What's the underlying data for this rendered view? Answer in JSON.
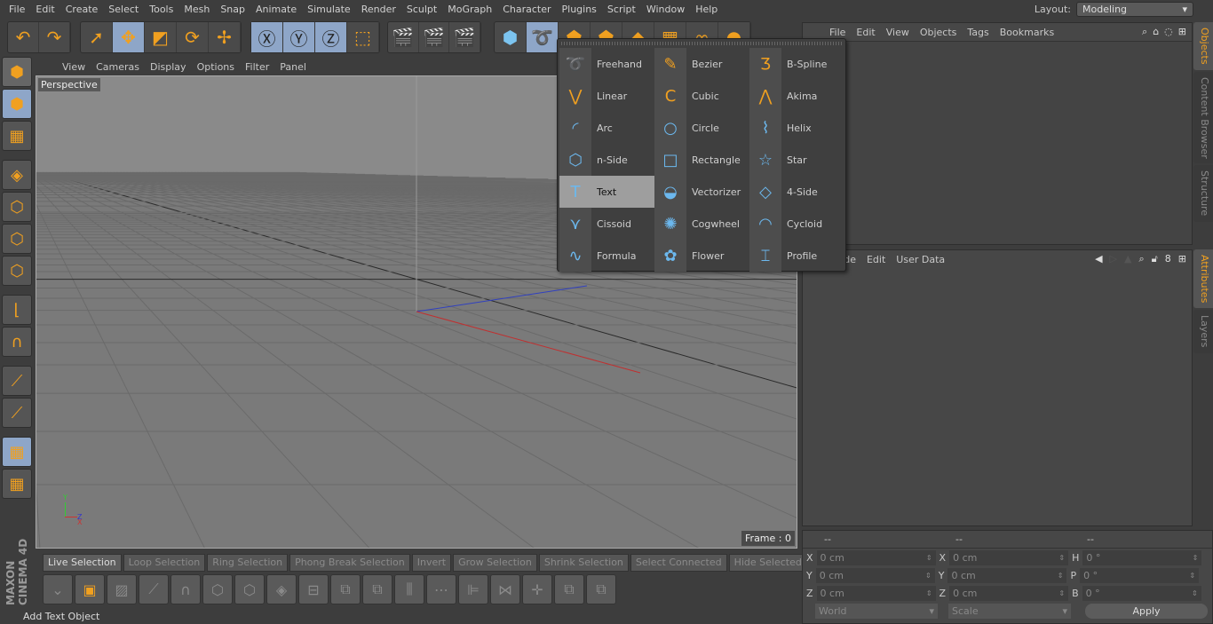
{
  "menubar": [
    "File",
    "Edit",
    "Create",
    "Select",
    "Tools",
    "Mesh",
    "Snap",
    "Animate",
    "Simulate",
    "Render",
    "Sculpt",
    "MoGraph",
    "Character",
    "Plugins",
    "Script",
    "Window",
    "Help"
  ],
  "layout": {
    "label": "Layout:",
    "value": "Modeling"
  },
  "toolbar": {
    "groups": [
      [
        "undo-icon",
        "redo-icon"
      ],
      [
        "live-select-icon",
        "move-icon",
        "scale-icon",
        "rotate-icon",
        "move-axis-icon"
      ],
      [
        "x-axis-lock-icon",
        "y-axis-lock-icon",
        "z-axis-lock-icon",
        "coordinate-system-icon"
      ],
      [
        "render-view-icon",
        "render-picture-viewer-icon",
        "render-settings-icon"
      ],
      [
        "cube-icon",
        "spline-icon",
        "nurbs-icon",
        "array-icon",
        "deformer-icon",
        "floor-icon",
        "camera-icon",
        "light-icon"
      ]
    ],
    "glyphs": [
      "↶",
      "↷",
      "➚",
      "✥",
      "◩",
      "⟳",
      "✢",
      "Ⓧ",
      "Ⓨ",
      "Ⓩ",
      "⬚",
      "🎬",
      "🎬",
      "🎬",
      "⬢",
      "➰",
      "⬟",
      "⬟",
      "◆",
      "▦",
      "∞",
      "●"
    ]
  },
  "viewport": {
    "menu": [
      "View",
      "Cameras",
      "Display",
      "Options",
      "Filter",
      "Panel"
    ],
    "camera": "Perspective",
    "frame": "Frame : 0",
    "axis": {
      "x": "X",
      "y": "Y",
      "z": "Z"
    }
  },
  "left_tools": [
    "make-editable",
    "model-mode",
    "texture-mode",
    "workplane-mode",
    "points-mode",
    "edges-mode",
    "polygons-mode",
    "axis-mode",
    "snap-magnet",
    "knife",
    "line",
    "lock-workplane",
    "sculpt-mode"
  ],
  "selection_bar": [
    "Live Selection",
    "Loop Selection",
    "Ring Selection",
    "Phong Break Selection",
    "Invert",
    "Grow Selection",
    "Shrink Selection",
    "Select Connected",
    "Hide Selected",
    "Hid"
  ],
  "status": "Add Text Object",
  "logo": "MAXON CINEMA 4D",
  "objects_panel": {
    "menu": [
      "File",
      "Edit",
      "View",
      "Objects",
      "Tags",
      "Bookmarks"
    ]
  },
  "attributes_panel": {
    "menu": [
      "Mode",
      "Edit",
      "User Data"
    ]
  },
  "side_tabs": {
    "top": [
      "Objects",
      "Content Browser",
      "Structure"
    ],
    "bottom": [
      "Attributes",
      "Layers"
    ]
  },
  "coords": {
    "headers": [
      "--",
      "--",
      "--"
    ],
    "rows": [
      [
        "X",
        "0 cm",
        "X",
        "0 cm",
        "H",
        "0 °"
      ],
      [
        "Y",
        "0 cm",
        "Y",
        "0 cm",
        "P",
        "0 °"
      ],
      [
        "Z",
        "0 cm",
        "Z",
        "0 cm",
        "B",
        "0 °"
      ]
    ],
    "world": "World",
    "scale": "Scale",
    "apply": "Apply"
  },
  "spline_menu": {
    "items": [
      {
        "label": "Freehand",
        "glyph": "➰",
        "orange": true
      },
      {
        "label": "Bezier",
        "glyph": "✎",
        "orange": true
      },
      {
        "label": "B-Spline",
        "glyph": "Ʒ",
        "orange": true
      },
      {
        "label": "Linear",
        "glyph": "⋁",
        "orange": true
      },
      {
        "label": "Cubic",
        "glyph": "C",
        "orange": true
      },
      {
        "label": "Akima",
        "glyph": "⋀",
        "orange": true
      },
      {
        "label": "Arc",
        "glyph": "◜"
      },
      {
        "label": "Circle",
        "glyph": "○"
      },
      {
        "label": "Helix",
        "glyph": "⌇"
      },
      {
        "label": "n-Side",
        "glyph": "⬡"
      },
      {
        "label": "Rectangle",
        "glyph": "□"
      },
      {
        "label": "Star",
        "glyph": "☆"
      },
      {
        "label": "Text",
        "glyph": "T",
        "highlighted": true
      },
      {
        "label": "Vectorizer",
        "glyph": "◒"
      },
      {
        "label": "4-Side",
        "glyph": "◇"
      },
      {
        "label": "Cissoid",
        "glyph": "⋎"
      },
      {
        "label": "Cogwheel",
        "glyph": "✺"
      },
      {
        "label": "Cycloid",
        "glyph": "◠"
      },
      {
        "label": "Formula",
        "glyph": "∿"
      },
      {
        "label": "Flower",
        "glyph": "✿"
      },
      {
        "label": "Profile",
        "glyph": "⌶"
      }
    ]
  },
  "colors": {
    "accent": "#f0a020",
    "active_button": "#8ea6c8",
    "spline_icon": "#6cb8ee",
    "x_axis": "#c03030",
    "z_axis": "#3040c0"
  }
}
